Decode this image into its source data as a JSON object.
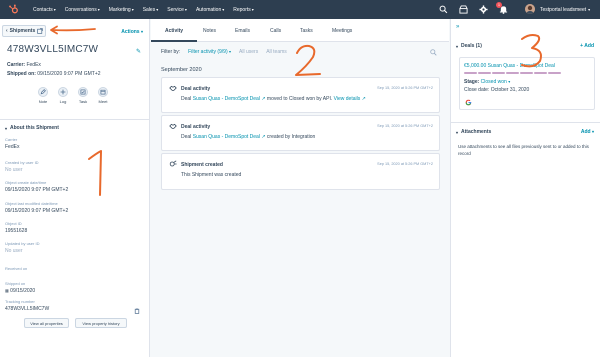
{
  "nav": {
    "items": [
      "Contacts",
      "Conversations",
      "Marketing",
      "Sales",
      "Service",
      "Automation",
      "Reports"
    ],
    "notification_count": "1",
    "account_name": "Testportal leadsmeet"
  },
  "left": {
    "back_label": "Shipments",
    "actions_label": "Actions",
    "record_title": "478W3VLL5IMC7W",
    "carrier_label": "Carrier:",
    "carrier_value": "FedEx",
    "shipped_label": "Shipped on:",
    "shipped_value": "09/15/2020 9:07 PM GMT+2",
    "quick_actions": [
      "Note",
      "Log",
      "Task",
      "Meet"
    ],
    "section_title": "About this Shipment",
    "properties": [
      {
        "label": "Carrier",
        "value": "FedEx",
        "muted": false
      },
      {
        "label": "Created by user ID",
        "value": "No user",
        "muted": true
      },
      {
        "label": "Object create date/time",
        "value": "09/15/2020 9:07 PM GMT+2",
        "muted": false
      },
      {
        "label": "Object last modified date/time",
        "value": "09/15/2020 9:07 PM GMT+2",
        "muted": false
      },
      {
        "label": "Object ID",
        "value": "19551628",
        "muted": false
      },
      {
        "label": "Updated by user ID",
        "value": "No user",
        "muted": true
      },
      {
        "label": "Received on",
        "value": "",
        "muted": true
      },
      {
        "label": "Shipped on",
        "value": "09/15/2020",
        "muted": false
      },
      {
        "label": "Tracking number",
        "value": "478W3VLL5IMC7W",
        "muted": false
      }
    ],
    "view_all_label": "View all properties",
    "view_history_label": "View property history"
  },
  "tabs": [
    "Activity",
    "Notes",
    "Emails",
    "Calls",
    "Tasks",
    "Meetings"
  ],
  "filter": {
    "label": "Filter by:",
    "value": "Filter activity (9/9)",
    "users": "All users",
    "teams": "All teams"
  },
  "timeline": {
    "month": "September 2020",
    "items": [
      {
        "title": "Deal activity",
        "date": "Sep 15, 2020 at 5:26 PM GMT+2",
        "pre": "Deal ",
        "link": "Susan Quas - DemoSpot Deal",
        "post": " moved to Closed won by API. ",
        "link2": "View details"
      },
      {
        "title": "Deal activity",
        "date": "Sep 15, 2020 at 5:26 PM GMT+2",
        "pre": "Deal ",
        "link": "Susan Quas - DemoSpot Deal",
        "post": " created by Integration",
        "link2": ""
      },
      {
        "title": "Shipment created",
        "date": "Sep 15, 2020 at 5:26 PM GMT+2",
        "pre": "This Shipment was created",
        "link": "",
        "post": "",
        "link2": ""
      }
    ]
  },
  "right": {
    "deals_title": "Deals (1)",
    "add_label": "+ Add",
    "deal_amount": "€5,000.00 Susan Quas - DemoSpot Deal",
    "stage_label": "Stage:",
    "stage_value": "Closed won",
    "close_label": "Close date:",
    "close_value": "October 31, 2020",
    "attachments_title": "Attachments",
    "attachments_add": "Add",
    "attachments_text": "Use attachments to see all files previously sent to or added to this record"
  },
  "annotations": [
    "1",
    "2",
    "3"
  ],
  "colors": {
    "nav": "#2d3e50",
    "link": "#0091ae",
    "annotation": "#e8692c",
    "pipeline_done": "#c8a2c8"
  }
}
